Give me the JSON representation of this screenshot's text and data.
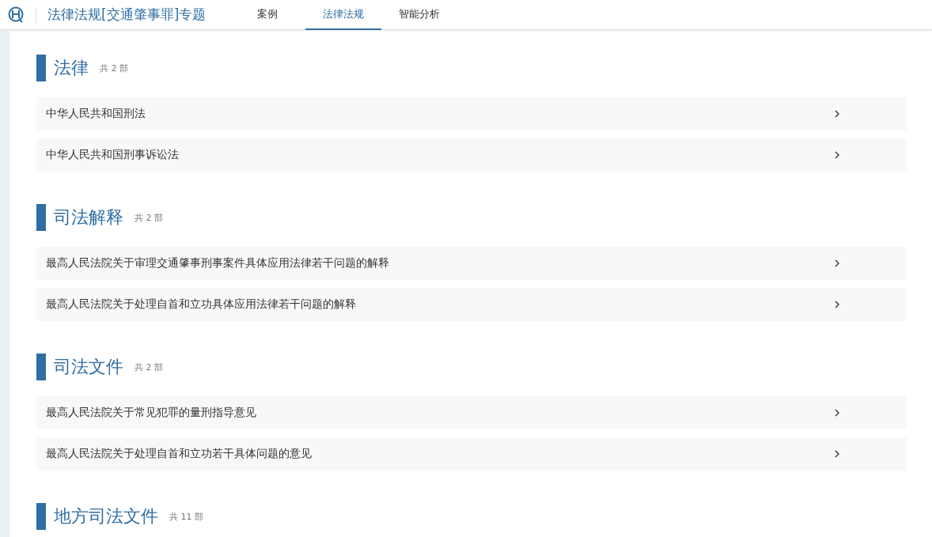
{
  "header": {
    "title": "法律法规[交通肇事罪]专题"
  },
  "tabs": [
    {
      "label": "案例",
      "selected": false
    },
    {
      "label": "法律法规",
      "selected": true
    },
    {
      "label": "智能分析",
      "selected": false
    }
  ],
  "sections": [
    {
      "title": "法律",
      "count": "共 2 部",
      "items": [
        "中华人民共和国刑法",
        "中华人民共和国刑事诉讼法"
      ]
    },
    {
      "title": "司法解释",
      "count": "共 2 部",
      "items": [
        "最高人民法院关于审理交通肇事刑事案件具体应用法律若干问题的解释",
        "最高人民法院关于处理自首和立功具体应用法律若干问题的解释"
      ]
    },
    {
      "title": "司法文件",
      "count": "共 2 部",
      "items": [
        "最高人民法院关于常见犯罪的量刑指导意见",
        "最高人民法院关于处理自首和立功若干具体问题的意见"
      ]
    },
    {
      "title": "地方司法文件",
      "count": "共 11 部"
    }
  ]
}
